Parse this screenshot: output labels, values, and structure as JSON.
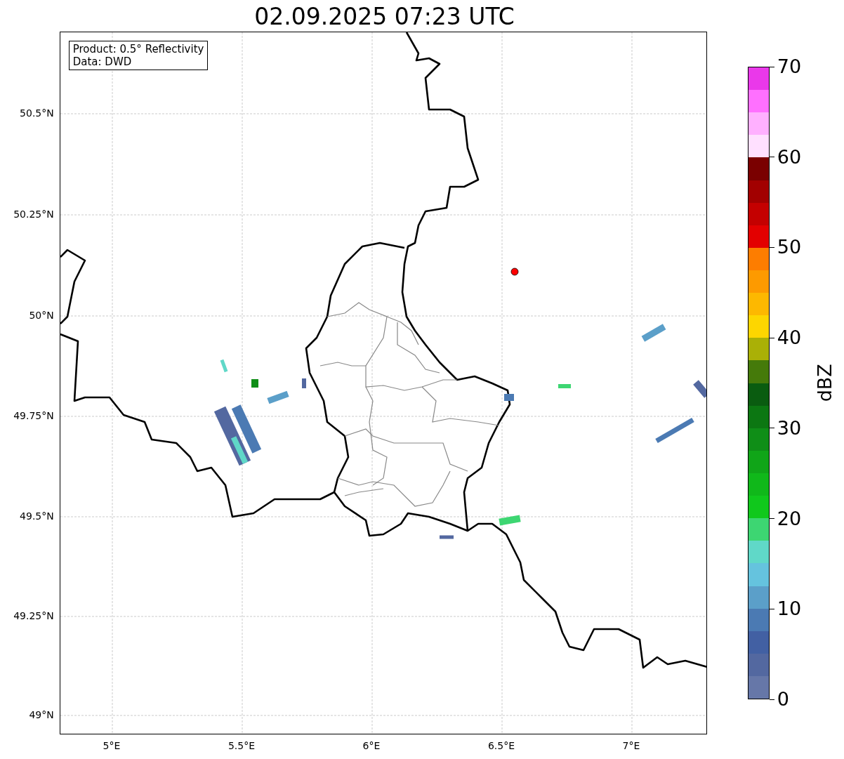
{
  "title": "02.09.2025 07:23 UTC",
  "info_box": [
    "Product: 0.5° Reflectivity",
    "Data: DWD"
  ],
  "map": {
    "x_ticks": [
      "5°E",
      "5.5°E",
      "6°E",
      "6.5°E",
      "7°E"
    ],
    "y_ticks": [
      "50.5°N",
      "50.25°N",
      "50°N",
      "49.75°N",
      "49.5°N",
      "49.25°N",
      "49°N"
    ]
  },
  "colorbar": {
    "label": "dBZ",
    "ticks": [
      "70",
      "60",
      "50",
      "40",
      "30",
      "20",
      "10",
      "0"
    ],
    "bins": [
      {
        "color": "#ea38ea"
      },
      {
        "color": "#ff70ff"
      },
      {
        "color": "#ffb0ff"
      },
      {
        "color": "#ffe0ff"
      },
      {
        "color": "#7a0000"
      },
      {
        "color": "#a20000"
      },
      {
        "color": "#c40000"
      },
      {
        "color": "#e30000"
      },
      {
        "color": "#fd7d00"
      },
      {
        "color": "#fd9a00"
      },
      {
        "color": "#fdb800"
      },
      {
        "color": "#fdd600"
      },
      {
        "color": "#aab006"
      },
      {
        "color": "#457a0a"
      },
      {
        "color": "#0a5c10"
      },
      {
        "color": "#0c7712"
      },
      {
        "color": "#0f8e17"
      },
      {
        "color": "#10a518"
      },
      {
        "color": "#10b81a"
      },
      {
        "color": "#10c81c"
      },
      {
        "color": "#3dd672"
      },
      {
        "color": "#60d8c8"
      },
      {
        "color": "#65c3de"
      },
      {
        "color": "#5b9fc9"
      },
      {
        "color": "#4b7ab3"
      },
      {
        "color": "#4260a3"
      },
      {
        "color": "#5368a0"
      },
      {
        "color": "#6677a8"
      }
    ]
  }
}
